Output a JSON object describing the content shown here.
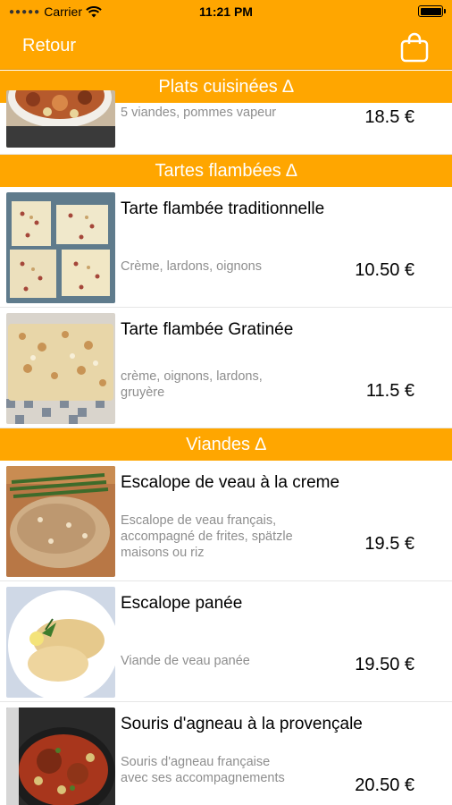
{
  "status": {
    "carrier": "Carrier",
    "time": "11:21 PM"
  },
  "nav": {
    "back_label": "Retour"
  },
  "sections": [
    {
      "title": "Plats cuisinées ∆"
    },
    {
      "title": "Tartes flambées ∆"
    },
    {
      "title": "Viandes ∆"
    }
  ],
  "items": [
    {
      "title": "",
      "desc": "5 viandes, pommes vapeur",
      "price": "18.5 €"
    },
    {
      "title": "Tarte flambée traditionnelle",
      "desc": "Crème, lardons, oignons",
      "price": "10.50 €"
    },
    {
      "title": "Tarte flambée Gratinée",
      "desc": "crème, oignons, lardons, gruyère",
      "price": "11.5 €"
    },
    {
      "title": "Escalope de veau à la creme",
      "desc": "Escalope de veau français, accompagné de frites, spätzle maisons ou riz",
      "price": "19.5 €"
    },
    {
      "title": "Escalope panée",
      "desc": "Viande de veau panée",
      "price": "19.50 €"
    },
    {
      "title": "Souris d'agneau à la provençale",
      "desc": "Souris d'agneau française avec ses accompagnements",
      "price": "20.50 €"
    }
  ]
}
